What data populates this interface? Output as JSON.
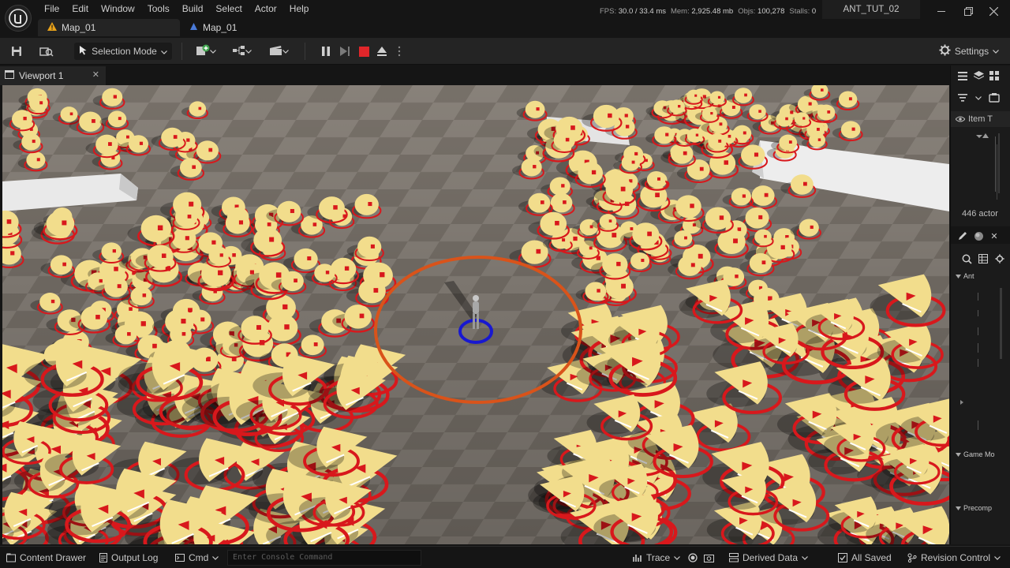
{
  "menu": [
    "File",
    "Edit",
    "Window",
    "Tools",
    "Build",
    "Select",
    "Actor",
    "Help"
  ],
  "tabs": [
    {
      "label": "Map_01",
      "icon": "warning-icon"
    },
    {
      "label": "Map_01",
      "icon": "level-icon"
    }
  ],
  "stats": {
    "fps_label": "FPS:",
    "fps": "30.0",
    "ms": "/ 33.4 ms",
    "mem_label": "Mem:",
    "mem": "2,925.48 mb",
    "objs_label": "Objs:",
    "objs": "100,278",
    "stalls_label": "Stalls:",
    "stalls": "0"
  },
  "project_name": "ANT_TUT_02",
  "toolbar": {
    "selection_mode": "Selection Mode",
    "settings": "Settings"
  },
  "viewport": {
    "tab_label": "Viewport 1"
  },
  "outliner": {
    "item_header": "Item T",
    "actor_count": "446 actor"
  },
  "details": {
    "categories": [
      "Ant",
      "Game Mo",
      "Precomp"
    ]
  },
  "statusbar": {
    "content_drawer": "Content Drawer",
    "output_log": "Output Log",
    "cmd": "Cmd",
    "console_placeholder": "Enter Console Command",
    "trace": "Trace",
    "derived_data": "Derived Data",
    "all_saved": "All Saved",
    "revision_control": "Revision Control"
  },
  "colors": {
    "cone": "#f2dd8c",
    "ring": "#d8181c",
    "player_ring": "#1818d0",
    "range_circle": "#d9531a",
    "stop_red": "#e0262a"
  }
}
